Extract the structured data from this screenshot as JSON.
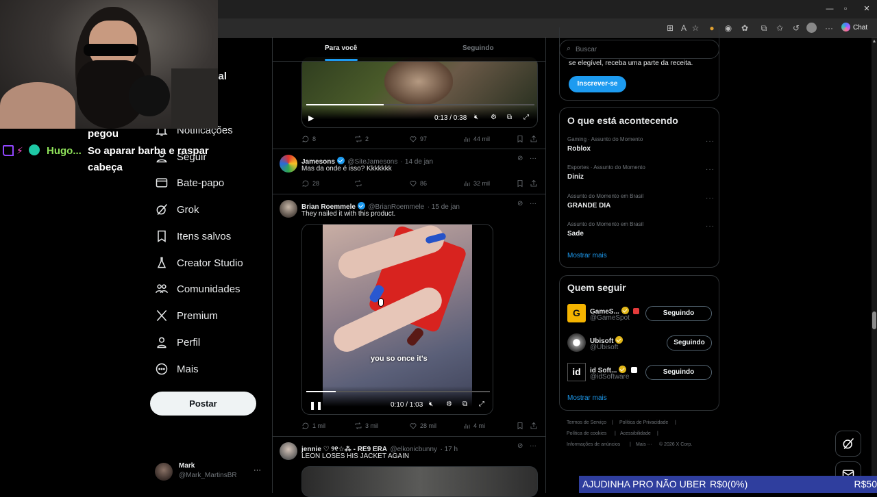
{
  "browser": {
    "window_controls": {
      "minimize": "—",
      "maximize": "▫",
      "close": "✕"
    },
    "chat_label": "Chat"
  },
  "stream_chat": {
    "line1": "pegou",
    "user": "Hugo...",
    "line2": "So aparar barba e raspar",
    "line3": "cabeça"
  },
  "sidebar": {
    "items": [
      {
        "label": "Notificações",
        "icon": "bell-icon"
      },
      {
        "label": "Seguir",
        "icon": "person-icon"
      },
      {
        "label": "Bate-papo",
        "icon": "mail-icon"
      },
      {
        "label": "Grok",
        "icon": "grok-icon"
      },
      {
        "label": "Itens salvos",
        "icon": "bookmark-icon"
      },
      {
        "label": "Creator Studio",
        "icon": "flask-icon"
      },
      {
        "label": "Comunidades",
        "icon": "people-icon"
      },
      {
        "label": "Premium",
        "icon": "x-logo-icon"
      },
      {
        "label": "Perfil",
        "icon": "profile-icon"
      },
      {
        "label": "Mais",
        "icon": "more-circle-icon"
      }
    ],
    "partial_label": "cial",
    "post_button": "Postar",
    "account": {
      "name": "Mark",
      "handle": "@Mark_MartinsBR",
      "more": "···"
    }
  },
  "feed": {
    "tabs": [
      {
        "label": "Para você",
        "active": true
      },
      {
        "label": "Seguindo",
        "active": false
      }
    ],
    "video1": {
      "time": "0:13 / 0:38",
      "progress": 0.34
    },
    "post0_actions": {
      "replies": "8",
      "reposts": "2",
      "likes": "97",
      "views": "44 mil"
    },
    "post1": {
      "name": "Jamesons",
      "handle": "@SiteJamesons",
      "date": "· 14 de jan",
      "text": "Mas da onde é isso? Kkkkkkk",
      "actions": {
        "replies": "28",
        "reposts": "",
        "likes": "86",
        "views": "32 mil"
      }
    },
    "post2": {
      "name": "Brian Roemmele",
      "handle": "@BrianRoemmele",
      "date": "· 15 de jan",
      "text": "They nailed it with this product.",
      "caption": "you so once it's",
      "video_time": "0:10 / 1:03",
      "progress": 0.16,
      "actions": {
        "replies": "1 mil",
        "reposts": "3 mil",
        "likes": "28 mil",
        "views": "4 mi"
      }
    },
    "post3": {
      "name": "jennie ♡ ୨୧☆⁂ - RE9 ERA",
      "handle": "@elkonicbunny",
      "date": "· 17 h",
      "text": "LEON LOSES HIS JACKET AGAIN"
    }
  },
  "right": {
    "search_placeholder": "Buscar",
    "premium_text": "se elegível, receba uma parte da receita.",
    "subscribe_button": "Inscrever-se",
    "trends_title": "O que está acontecendo",
    "trends": [
      {
        "category": "Gaming · Assunto do Momento",
        "name": "Roblox"
      },
      {
        "category": "Esportes · Assunto do Momento",
        "name": "Diniz"
      },
      {
        "category": "Assunto do Momento em Brasil",
        "name": "GRANDE DIA"
      },
      {
        "category": "Assunto do Momento em Brasil",
        "name": "Sade"
      }
    ],
    "show_more": "Mostrar mais",
    "who_title": "Quem seguir",
    "who": [
      {
        "name": "GameS...",
        "handle": "@GameSpot",
        "button": "Seguindo"
      },
      {
        "name": "Ubisoft",
        "handle": "@Ubisoft",
        "button": "Seguindo"
      },
      {
        "name": "id Soft...",
        "handle": "@idSoftware",
        "button": "Seguindo"
      }
    ],
    "footer": {
      "terms": "Termos de Serviço",
      "privacy": "Política de Privacidade",
      "cookies": "Política de cookies",
      "accessibility": "Acessibilidade",
      "ads": "Informações de anúncios",
      "more": "Mais ···",
      "copyright": "© 2026 X Corp."
    }
  },
  "donation_bar": {
    "text": "AJUDINHA PRO NÃO UBER",
    "progress": "R$0(0%)",
    "goal": "R$50"
  },
  "colors": {
    "accent": "#1d9bf0",
    "background": "#000000",
    "border": "#2f3336",
    "muted": "#71767b"
  }
}
